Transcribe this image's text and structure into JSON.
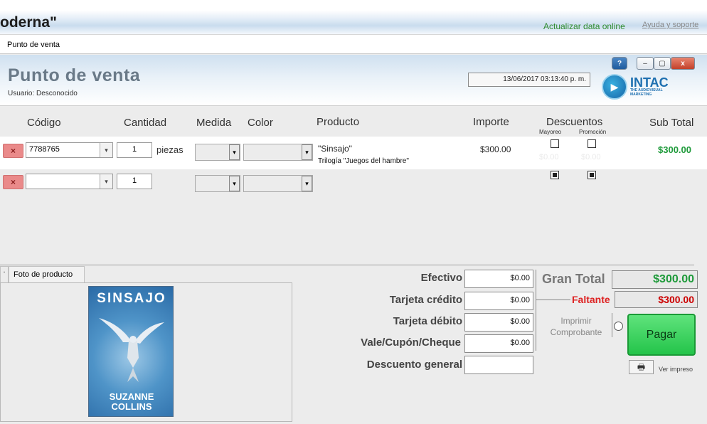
{
  "app": {
    "title": "oderna\"",
    "sync_link": "Actualizar data online",
    "help_link": "Ayuda y soporte"
  },
  "tab": {
    "label": "Punto de venta"
  },
  "header": {
    "title": "Punto de venta",
    "user": "Usuario: Desconocido",
    "datetime": "13/06/2017 03:13:40 p. m.",
    "help_btn": "?",
    "min_btn": "–",
    "max_btn": "▢",
    "close_btn": "x",
    "logo_text": "INTAC",
    "logo_sub": "THE AUDIOVISUAL MARKETING"
  },
  "columns": {
    "codigo": "Código",
    "cantidad": "Cantidad",
    "medida": "Medida",
    "color": "Color",
    "producto": "Producto",
    "importe": "Importe",
    "descuentos": "Descuentos",
    "mayoreo": "Mayoreo",
    "promocion": "Promoción",
    "subtotal": "Sub Total"
  },
  "rows": [
    {
      "delete": "×",
      "code": "7788765",
      "qty": "1",
      "unit": "piezas",
      "product": "\"Sinsajo\"",
      "product_sub": "Trilogía \"Juegos del hambre\"",
      "importe": "$300.00",
      "mayoreo_amt": "$0.00",
      "promo_amt": "$0.00",
      "subtotal": "$300.00"
    },
    {
      "delete": "×",
      "code": "",
      "qty": "1"
    }
  ],
  "photo": {
    "tab_stub": ".",
    "tab_label": "Foto de producto",
    "book_title": "SINSAJO",
    "book_author": "SUZANNE COLLINS"
  },
  "payment": {
    "efectivo_label": "Efectivo",
    "efectivo": "$0.00",
    "credito_label": "Tarjeta crédito",
    "credito": "$0.00",
    "debito_label": "Tarjeta débito",
    "debito": "$0.00",
    "vale_label": "Vale/Cupón/Cheque",
    "vale": "$0.00",
    "descuento_label": "Descuento general",
    "descuento": ""
  },
  "totals": {
    "gran_label": "Gran Total",
    "gran_value": "$300.00",
    "faltante_label": "Faltante",
    "faltante_value": "$300.00",
    "print_label": "Imprimir Comprobante",
    "pay_button": "Pagar",
    "print_preview_icon": "🖶",
    "print_preview_label": "Ver impreso"
  },
  "colors": {
    "accent_green": "#24c44a",
    "alert_red": "#d22222",
    "subtotal_green": "#1e9a3a"
  }
}
